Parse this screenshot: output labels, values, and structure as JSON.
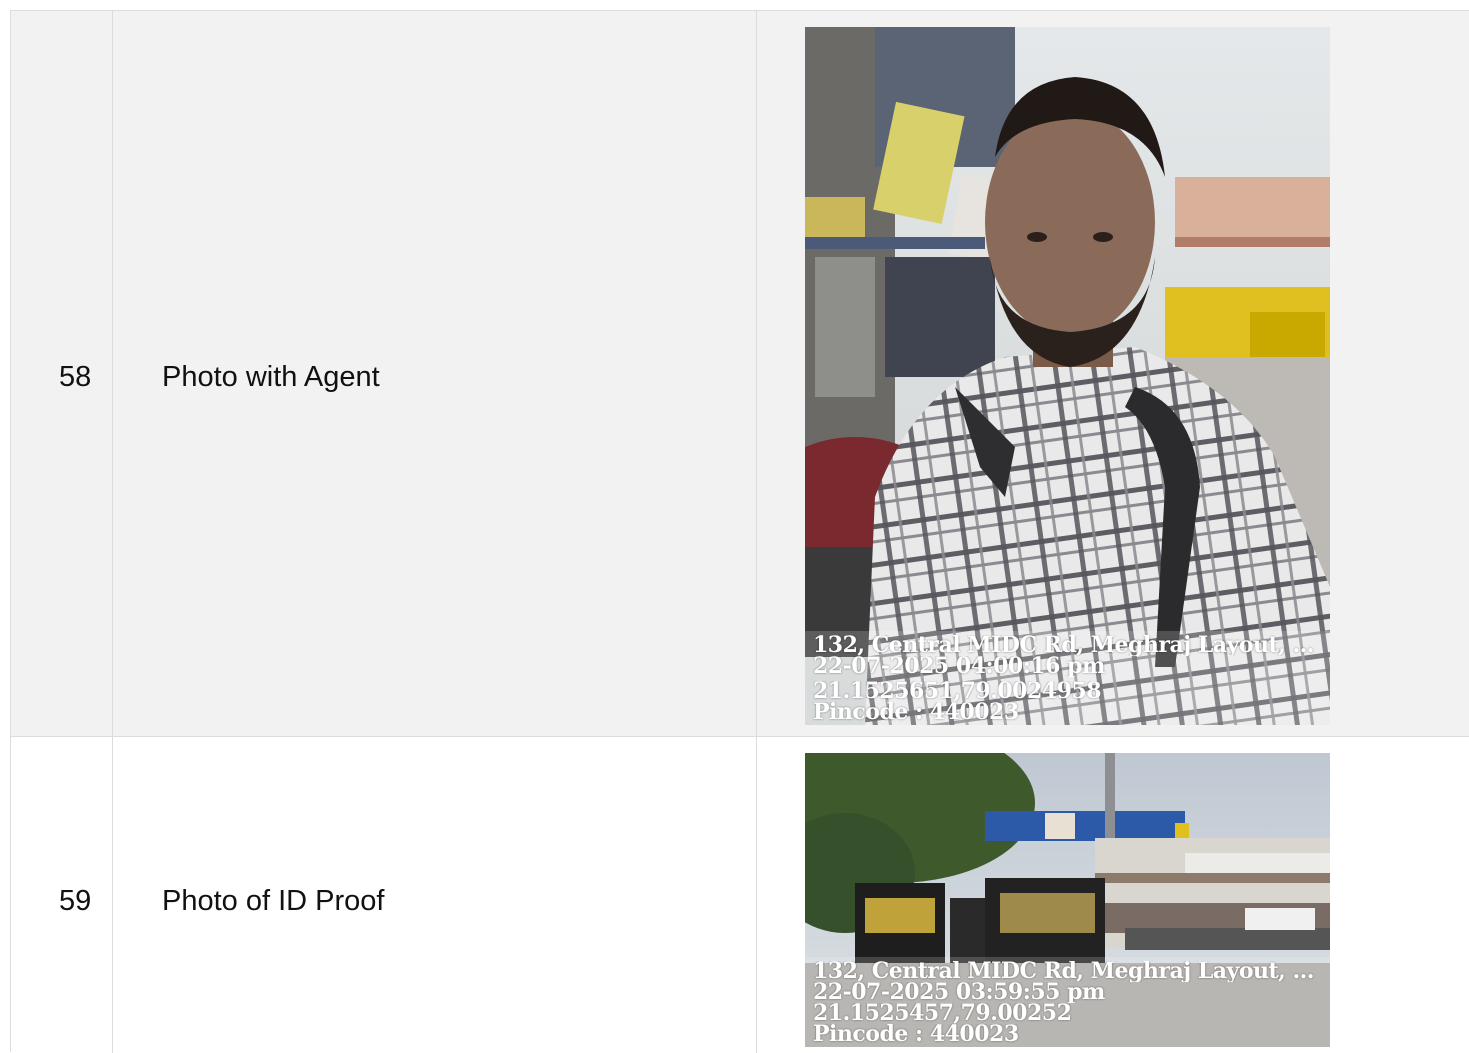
{
  "rows": [
    {
      "number": "58",
      "label": "Photo with Agent",
      "photo": {
        "stamp": {
          "address": "132, Central MIDC Rd, Meghraj Layout, ...",
          "datetime": "22-07-2025 04:00:16 pm",
          "coords": "21.1525651,79.0024958",
          "pincode": "Pincode : 440023"
        }
      }
    },
    {
      "number": "59",
      "label": "Photo of ID Proof",
      "photo": {
        "stamp": {
          "address": "132, Central MIDC Rd, Meghraj Layout, ...",
          "datetime": "22-07-2025 03:59:55 pm",
          "coords": "21.1525457,79.00252",
          "pincode": "Pincode : 440023"
        }
      }
    }
  ]
}
